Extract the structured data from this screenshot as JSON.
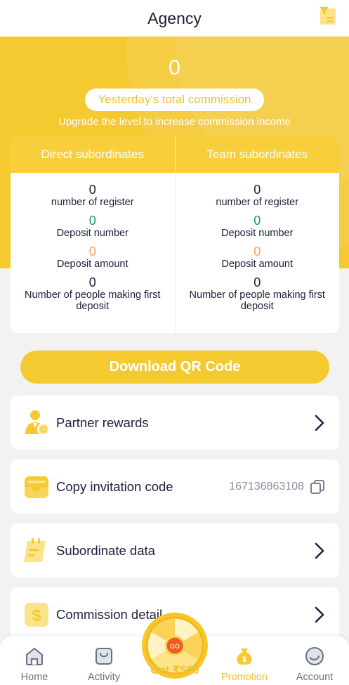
{
  "header": {
    "title": "Agency",
    "filter_icon": "filter-icon"
  },
  "hero": {
    "commission_value": "0",
    "commission_label": "Yesterday's total commission",
    "subtitle": "Upgrade the level to increase commission income"
  },
  "stats": {
    "columns": [
      {
        "title": "Direct subordinates",
        "register_count": "0",
        "register_label": "number of register",
        "deposit_number": "0",
        "deposit_number_label": "Deposit number",
        "deposit_amount": "0",
        "deposit_amount_label": "Deposit amount",
        "first_deposit": "0",
        "first_deposit_label": "Number of people making first deposit"
      },
      {
        "title": "Team subordinates",
        "register_count": "0",
        "register_label": "number of register",
        "deposit_number": "0",
        "deposit_number_label": "Deposit number",
        "deposit_amount": "0",
        "deposit_amount_label": "Deposit amount",
        "first_deposit": "0",
        "first_deposit_label": "Number of people making first deposit"
      }
    ]
  },
  "qr_button": {
    "label": "Download QR Code"
  },
  "menu": {
    "partner_rewards": {
      "label": "Partner rewards",
      "icon": "partner-icon"
    },
    "copy_invitation": {
      "label": "Copy invitation code",
      "code": "167136863108",
      "icon": "inbox-icon"
    },
    "subordinate_data": {
      "label": "Subordinate data",
      "icon": "notepad-icon"
    },
    "commission_detail": {
      "label": "Commission detail",
      "icon": "dollar-icon"
    }
  },
  "nav": {
    "home": "Home",
    "activity": "Activity",
    "wheel_label": "Get ₹500",
    "wheel_button": "GO",
    "promotion": "Promotion",
    "account": "Account"
  },
  "colors": {
    "accent": "#f5c930",
    "green": "#19a05a",
    "orange": "#f8a15a",
    "text": "#1b1f3a"
  }
}
